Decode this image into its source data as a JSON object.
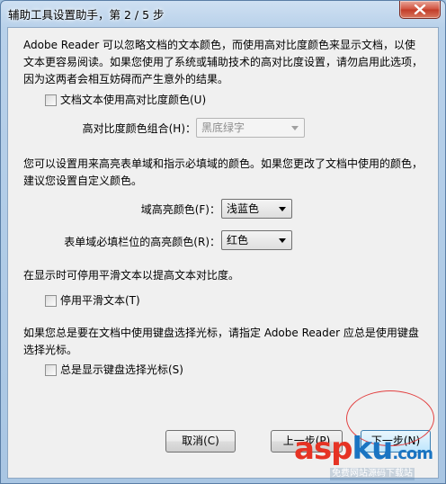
{
  "window": {
    "title": "辅助工具设置助手，第 2 / 5 步",
    "close_label": "✕"
  },
  "sections": {
    "intro_text": "Adobe Reader 可以忽略文档的文本颜色，而使用高对比度颜色来显示文档，以使文本更容易阅读。如果您使用了系统或辅助技术的高对比度设置，请勿启用此选项，因为这两者会相互妨碍而产生意外的结果。",
    "high_contrast_checkbox": {
      "label": "文档文本使用高对比度颜色(U)",
      "checked": false
    },
    "color_combo": {
      "label": "高对比度颜色组合(H)：",
      "value": "黑底绿字",
      "enabled": false
    },
    "field_text": "您可以设置用来高亮表单域和指示必填域的颜色。如果您更改了文档中使用的颜色，建议您设置自定义颜色。",
    "field_highlight": {
      "label": "域高亮颜色(F)：",
      "value": "浅蓝色"
    },
    "required_highlight": {
      "label": "表单域必填栏位的高亮颜色(R)：",
      "value": "红色"
    },
    "smooth_text": "在显示时可停用平滑文本以提高文本对比度。",
    "smooth_checkbox": {
      "label": "停用平滑文本(T)",
      "checked": false
    },
    "keyboard_text": "如果您总是要在文档中使用键盘选择光标，请指定 Adobe Reader 应总是使用键盘选择光标。",
    "keyboard_checkbox": {
      "label": "总是显示键盘选择光标(S)",
      "checked": false
    }
  },
  "buttons": {
    "cancel": "取消(C)",
    "back": "上一步(P)",
    "next": "下一步(N)"
  },
  "watermark": {
    "brand_a": "asp",
    "brand_b": "ku",
    "brand_c": ".com",
    "tagline": "免费网站源码下载站"
  },
  "colors": {
    "accent_red": "#e63324",
    "accent_blue": "#1a74c2"
  }
}
